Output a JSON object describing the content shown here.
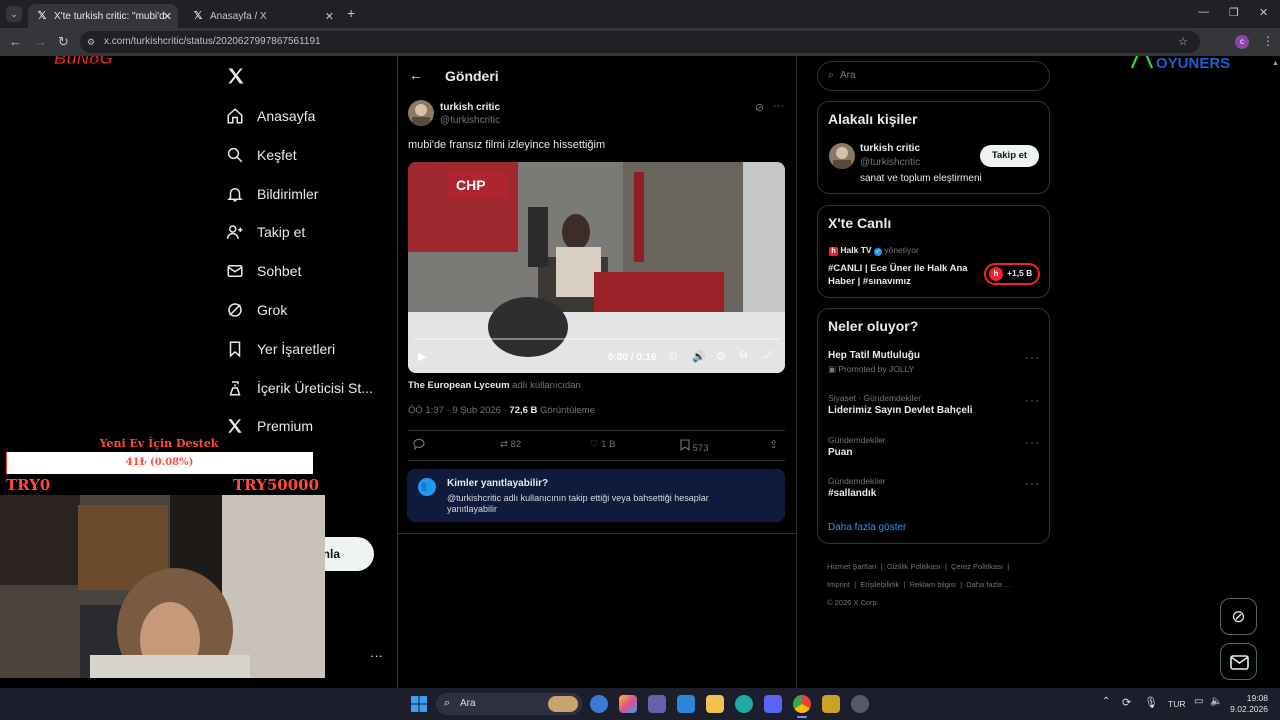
{
  "browser": {
    "tabs": [
      {
        "title": "X'te turkish critic: \"mubi'de fra"
      },
      {
        "title": "Anasayfa / X"
      }
    ],
    "url": "x.com/turkishcritic/status/2020627997867561191"
  },
  "sidebar": {
    "items": [
      {
        "label": "Anasayfa",
        "icon": "home-icon"
      },
      {
        "label": "Keşfet",
        "icon": "search-icon"
      },
      {
        "label": "Bildirimler",
        "icon": "bell-icon"
      },
      {
        "label": "Takip et",
        "icon": "person-plus-icon"
      },
      {
        "label": "Sohbet",
        "icon": "mail-icon"
      },
      {
        "label": "Grok",
        "icon": "grok-icon"
      },
      {
        "label": "Yer İşaretleri",
        "icon": "bookmark-icon"
      },
      {
        "label": "İçerik Üreticisi St...",
        "icon": "creator-icon"
      },
      {
        "label": "Premium",
        "icon": "x-logo-icon"
      }
    ],
    "post_button_partial": "nla"
  },
  "overlay": {
    "donation_title": "Yeni Ev İçin Destek",
    "donation_amount": "41₺ (0.08%)",
    "donation_progress": 0.0008,
    "range_min": "TRY0",
    "range_max": "TRY50000",
    "logo_left": "BunoGame",
    "logo_right": "OYUNERS"
  },
  "post": {
    "header_title": "Gönderi",
    "author_name": "turkish critic",
    "author_handle": "@turkishcritic",
    "text": "mubi'de fransız filmi izleyince hissettiğim",
    "video": {
      "time": "0:00 / 0:16",
      "sign_text": "CHP"
    },
    "attribution_name": "The European Lyceum",
    "attribution_suffix": "adlı kullanıcıdan",
    "time": "ÖÖ 1:37 · 9 Şub 2026 ·",
    "views_value": "72,6 B",
    "views_label": "Görüntüleme",
    "actions": {
      "retweets": "82",
      "likes": "1 B",
      "bookmarks": "573"
    },
    "reply_box": {
      "title": "Kimler yanıtlayabilir?",
      "text": "@turkishcritic adlı kullanıcının takip ettiği veya bahsettiği hesaplar yanıtlayabilir"
    }
  },
  "right": {
    "search_placeholder": "Ara",
    "related": {
      "title": "Alakalı kişiler",
      "name": "turkish critic",
      "handle": "@turkishcritic",
      "bio": "sanat ve toplum eleştirmeni",
      "follow_label": "Takip et"
    },
    "live": {
      "title": "X'te Canlı",
      "host": "Halk TV",
      "host_role": "yönetiyor",
      "stream_title": "#CANLI | Ece Üner ile Halk Ana Haber | #sınavımız",
      "listeners": "+1,5 B"
    },
    "trends": {
      "title": "Neler oluyor?",
      "items": [
        {
          "sub": "",
          "name": "Hep Tatil Mutluluğu",
          "promo": "Promoted by JOLLY"
        },
        {
          "sub": "Siyaset · Gündemdekiler",
          "name": "Liderimiz Sayın Devlet Bahçeli",
          "promo": ""
        },
        {
          "sub": "Gündemdekiler",
          "name": "Puan",
          "promo": ""
        },
        {
          "sub": "Gündemdekiler",
          "name": "#sallandık",
          "promo": ""
        }
      ],
      "show_more": "Daha fazla göster"
    },
    "footer": {
      "links": [
        "Hizmet Şartları",
        "Gizlilik Politikası",
        "Çerez Politikası",
        "Imprint",
        "Erişilebilirlik",
        "Reklam bilgisi",
        "Daha fazla ..."
      ],
      "copyright": "© 2026 X Corp."
    }
  },
  "taskbar": {
    "search_label": "Ara",
    "lang": "TUR",
    "time": "19:08",
    "date": "9.02.2026"
  },
  "colors": {
    "accent": "#1d9bf0",
    "background": "#000000",
    "border": "#2f3336",
    "donation_title": "#ff4a3d",
    "live_badge": "#f4212e"
  }
}
